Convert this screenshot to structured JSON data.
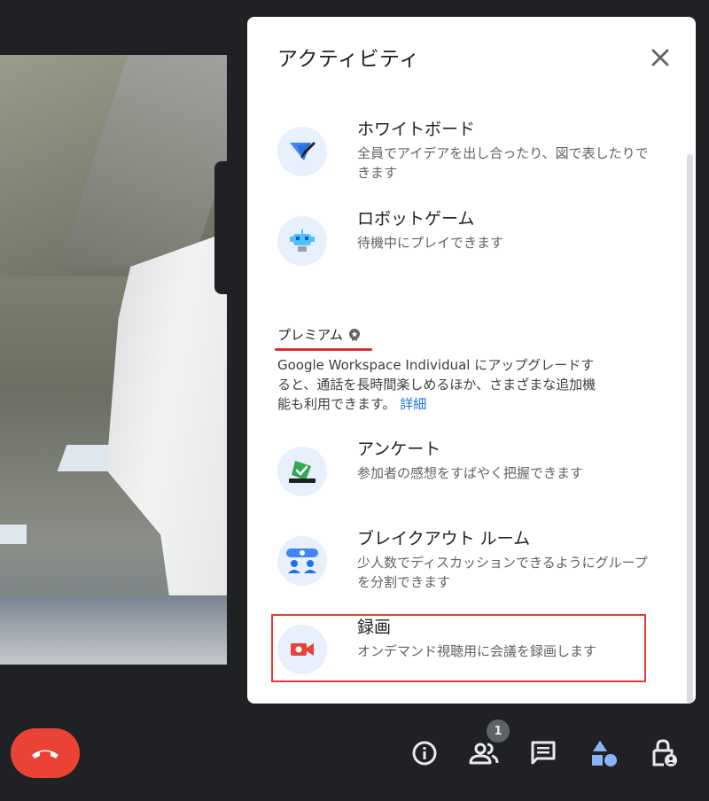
{
  "panel": {
    "title": "アクティビティ",
    "activities": [
      {
        "title": "ホワイトボード",
        "desc": "全員でアイデアを出し合ったり、図で表したりできます",
        "icon": "whiteboard-icon"
      },
      {
        "title": "ロボットゲーム",
        "desc": "待機中にプレイできます",
        "icon": "robot-game-icon"
      }
    ],
    "premium": {
      "title": "プレミアム",
      "desc": "Google Workspace Individual にアップグレードすると、通話を長時間楽しめるほか、さまざまな追加機能も利用できます。",
      "link": "詳細"
    },
    "premium_activities": [
      {
        "title": "アンケート",
        "desc": "参加者の感想をすばやく把握できます",
        "icon": "poll-icon"
      },
      {
        "title": "ブレイクアウト ルーム",
        "desc": "少人数でディスカッションできるようにグループを分割できます",
        "icon": "breakout-rooms-icon"
      },
      {
        "title": "録画",
        "desc": "オンデマンド視聴用に会議を録画します",
        "icon": "recording-icon"
      }
    ]
  },
  "toolbar": {
    "participants_count": "1"
  },
  "colors": {
    "accent": "#1a73e8",
    "end_call": "#ea4335",
    "highlight": "#e53935"
  }
}
